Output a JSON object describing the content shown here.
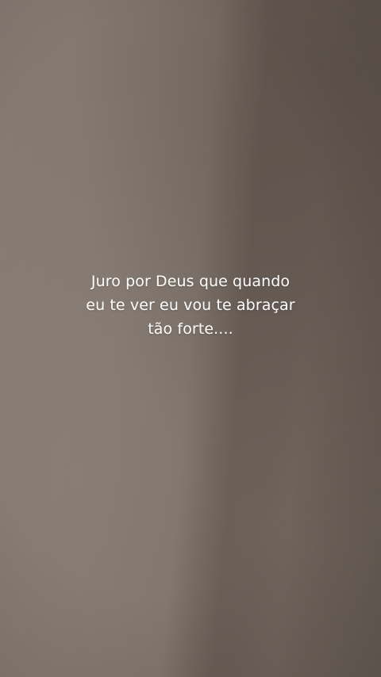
{
  "caption": {
    "lines": [
      "Juro por Deus que quando",
      "eu te ver eu vou te abraçar",
      "tão forte...."
    ],
    "color": "#ffffff"
  },
  "colors": {
    "background": "#7f746b"
  }
}
